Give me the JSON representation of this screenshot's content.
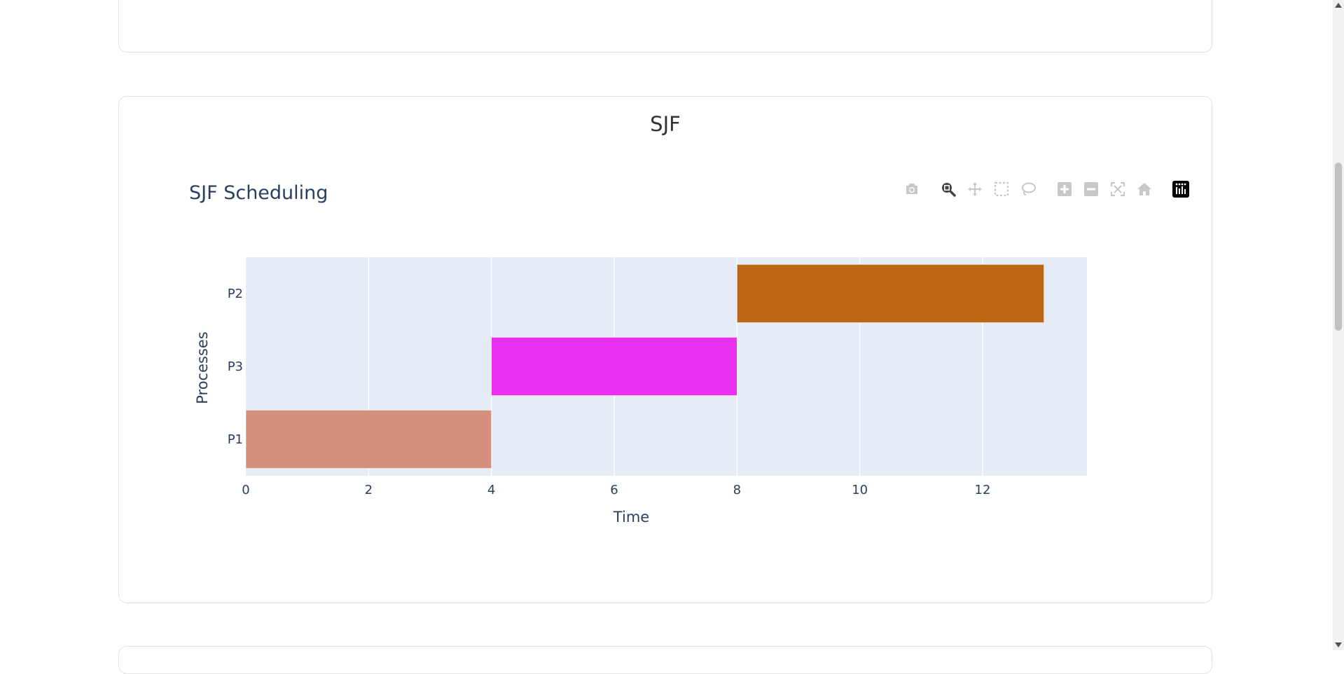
{
  "card": {
    "title": "SJF"
  },
  "plot": {
    "title": "SJF Scheduling"
  },
  "modebar": [
    {
      "name": "camera-icon"
    },
    {
      "name": "zoom-icon"
    },
    {
      "name": "pan-icon"
    },
    {
      "name": "box-select-icon"
    },
    {
      "name": "lasso-select-icon"
    },
    {
      "name": "zoom-in-icon"
    },
    {
      "name": "zoom-out-icon"
    },
    {
      "name": "autoscale-icon"
    },
    {
      "name": "reset-axes-icon"
    },
    {
      "name": "plotly-logo-icon"
    }
  ],
  "colors": {
    "plot_bg": "#e5ecf6",
    "grid": "#ffffff",
    "axis_text": "#2a3f5f",
    "P1": "#d4907f",
    "P3": "#e830ef",
    "P2": "#bd6614"
  },
  "chart_data": {
    "type": "bar",
    "orientation": "horizontal-gantt",
    "title": "SJF Scheduling",
    "xlabel": "Time",
    "ylabel": "Processes",
    "xlim": [
      0,
      13.7
    ],
    "xticks": [
      0,
      2,
      4,
      6,
      8,
      10,
      12
    ],
    "categories": [
      "P1",
      "P3",
      "P2"
    ],
    "tasks": [
      {
        "name": "P1",
        "start": 0,
        "end": 4
      },
      {
        "name": "P3",
        "start": 4,
        "end": 8
      },
      {
        "name": "P2",
        "start": 8,
        "end": 13
      }
    ],
    "grid": true,
    "legend": "none"
  }
}
